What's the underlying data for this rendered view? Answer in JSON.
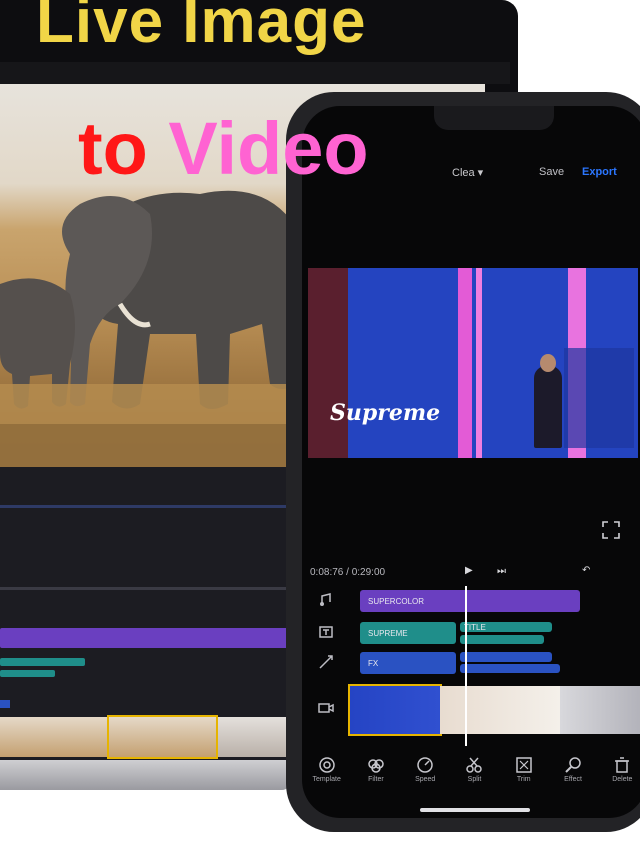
{
  "title": {
    "line1": "Live Image",
    "line2_part1": "to",
    "line2_part2": "Video"
  },
  "colors": {
    "title_line1": "#f1d547",
    "title_to": "#ff1717",
    "title_video": "#ff63d2",
    "accent_export": "#2b76ff",
    "selection_outline": "#e6b400",
    "track_purple": "#6a3fc0",
    "track_teal": "#1f8e8a",
    "track_blue": "#2a52c2"
  },
  "laptop": {
    "preview_subject": "elephants in savanna",
    "tool_icons": [
      "export-icon",
      "crop-icon",
      "frame-icon",
      "speed-icon",
      "delete-icon"
    ]
  },
  "phone": {
    "topbar": {
      "project_name": "Clea ▾",
      "save_label": "Save",
      "export_label": "Export"
    },
    "preview": {
      "overlay_text": "Supreme"
    },
    "transport": {
      "timecode": "0:08:76 / 0:29:00",
      "play_icon": "▶",
      "next_icon": "⏭",
      "undo_icon": "↶"
    },
    "tracks": [
      {
        "label": "SUPERCOLOR",
        "color": "#6a3fc0"
      },
      {
        "label": "SUPREME",
        "color": "#1f8e8a"
      },
      {
        "label": "TITLE",
        "color": "#1f8e8a"
      },
      {
        "label": "FX",
        "color": "#2a52c2"
      }
    ],
    "toolbar": [
      {
        "icon": "template-icon",
        "label": "Template"
      },
      {
        "icon": "filter-icon",
        "label": "Filter"
      },
      {
        "icon": "speed-icon",
        "label": "Speed"
      },
      {
        "icon": "split-icon",
        "label": "Split"
      },
      {
        "icon": "trim-icon",
        "label": "Trim"
      },
      {
        "icon": "effect-icon",
        "label": "Effect"
      },
      {
        "icon": "delete-icon",
        "label": "Delete"
      }
    ]
  }
}
